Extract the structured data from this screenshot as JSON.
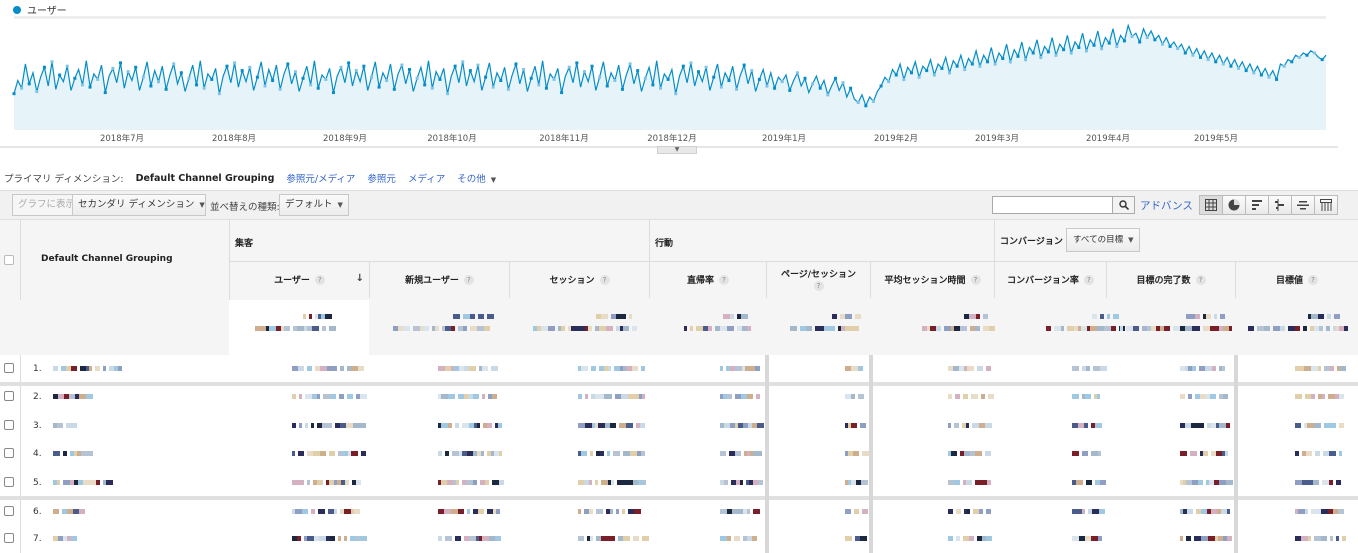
{
  "legend": {
    "label": "ユーザー",
    "color": "#058dc7"
  },
  "chart_data": {
    "type": "line",
    "series": [
      {
        "name": "ユーザー",
        "values": [
          33,
          45,
          38,
          60,
          42,
          52,
          35,
          48,
          57,
          40,
          62,
          37,
          50,
          44,
          58,
          36,
          47,
          55,
          41,
          63,
          39,
          51,
          46,
          59,
          34,
          49,
          56,
          43,
          61,
          38,
          53,
          45,
          57,
          36,
          48,
          62,
          40,
          54,
          44,
          58,
          37,
          50,
          60,
          42,
          52,
          35,
          47,
          59,
          41,
          63,
          38,
          51,
          46,
          56,
          33,
          49,
          58,
          43,
          61,
          39,
          54,
          44,
          57,
          36,
          48,
          62,
          40,
          55,
          45,
          59,
          37,
          51,
          60,
          42,
          53,
          35,
          47,
          58,
          41,
          63,
          38,
          50,
          46,
          56,
          34,
          49,
          57,
          43,
          61,
          40,
          54,
          44,
          58,
          36,
          48,
          62,
          39,
          52,
          45,
          60,
          37,
          51,
          59,
          42,
          55,
          35,
          47,
          57,
          41,
          63,
          38,
          53,
          46,
          56,
          33,
          49,
          58,
          43,
          62,
          40,
          54,
          44,
          59,
          36,
          48,
          61,
          39,
          52,
          45,
          57,
          37,
          50,
          60,
          42,
          55,
          35,
          47,
          58,
          41,
          63,
          38,
          51,
          46,
          56,
          34,
          49,
          57,
          43,
          61,
          39,
          53,
          44,
          58,
          36,
          48,
          62,
          40,
          52,
          45,
          59,
          37,
          50,
          60,
          42,
          54,
          35,
          47,
          57,
          41,
          63,
          38,
          51,
          46,
          55,
          33,
          49,
          58,
          43,
          61,
          40,
          53,
          44,
          57,
          36,
          48,
          60,
          39,
          52,
          45,
          58,
          37,
          50,
          59,
          42,
          54,
          35,
          46,
          55,
          40,
          52,
          38,
          48,
          44,
          50,
          36,
          45,
          52,
          40,
          47,
          34,
          42,
          49,
          38,
          45,
          32,
          40,
          47,
          36,
          43,
          30,
          38,
          28,
          25,
          32,
          22,
          30,
          26,
          35,
          40,
          48,
          44,
          55,
          50,
          60,
          46,
          57,
          52,
          62,
          48,
          58,
          54,
          64,
          50,
          60,
          56,
          66,
          52,
          63,
          58,
          68,
          55,
          65,
          60,
          72,
          58,
          68,
          62,
          75,
          60,
          70,
          65,
          78,
          62,
          73,
          67,
          80,
          64,
          75,
          70,
          82,
          66,
          76,
          71,
          84,
          68,
          78,
          73,
          86,
          70,
          80,
          75,
          88,
          72,
          82,
          77,
          90,
          74,
          84,
          79,
          92,
          76,
          86,
          81,
          95,
          85,
          88,
          80,
          92,
          84,
          90,
          82,
          86,
          78,
          84,
          76,
          80,
          74,
          78,
          70,
          76,
          68,
          74,
          66,
          72,
          64,
          70,
          62,
          68,
          60,
          66,
          58,
          64,
          56,
          62,
          54,
          60,
          52,
          58,
          50,
          56,
          48,
          54,
          46,
          60,
          58,
          64,
          62,
          68,
          66,
          70,
          68,
          72,
          70,
          66,
          64,
          68
        ],
        "unit": "users"
      }
    ],
    "x_tick_labels": [
      "2018年7月",
      "2018年8月",
      "2018年9月",
      "2018年10月",
      "2018年11月",
      "2018年12月",
      "2019年1月",
      "2019年2月",
      "2019年3月",
      "2019年4月",
      "2019年5月"
    ],
    "grid": false,
    "legend_position": "top-left"
  },
  "primary_dimension": {
    "label": "プライマリ ディメンション:",
    "active": "Default Channel Grouping",
    "links": [
      "参照元/メディア",
      "参照元",
      "メディア"
    ],
    "more": "その他"
  },
  "toolbar": {
    "plot_rows": "グラフに表示",
    "secondary_dimension": "セカンダリ ディメンション",
    "sort_type_label": "並べ替えの種類:",
    "sort_type_value": "デフォルト",
    "search_placeholder": "",
    "advanced": "アドバンス",
    "view_icons": [
      "data-table-icon",
      "pie-chart-icon",
      "performance-bar-icon",
      "comparison-icon",
      "term-cloud-icon",
      "pivot-icon"
    ]
  },
  "table": {
    "dimension_header": "Default Channel Grouping",
    "groups": {
      "acquisition": "集客",
      "behavior": "行動",
      "conversions": "コンバージョン"
    },
    "goal_select": "すべての目標",
    "metrics": [
      "ユーザー",
      "新規ユーザー",
      "セッション",
      "直帰率",
      "ページ/セッション",
      "平均セッション時間",
      "コンバージョン率",
      "目標の完了数",
      "目標値"
    ],
    "row_numbers": [
      "1.",
      "2.",
      "3.",
      "4.",
      "5.",
      "6.",
      "7."
    ]
  }
}
